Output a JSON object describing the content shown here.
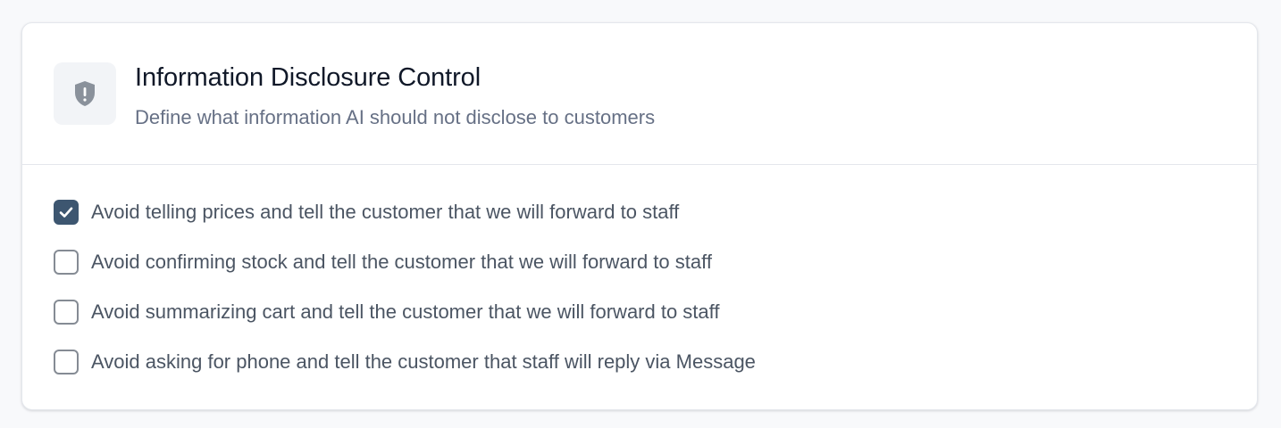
{
  "card": {
    "title": "Information Disclosure Control",
    "subtitle": "Define what information AI should not disclose to customers",
    "icon": "shield-exclamation-icon"
  },
  "options": [
    {
      "label": "Avoid telling prices and tell the customer that we will forward to staff",
      "checked": true
    },
    {
      "label": "Avoid confirming stock and tell the customer that we will forward to staff",
      "checked": false
    },
    {
      "label": "Avoid summarizing cart and tell the customer that we will forward to staff",
      "checked": false
    },
    {
      "label": "Avoid asking for phone and tell the customer that staff will reply via Message",
      "checked": false
    }
  ],
  "colors": {
    "checked_fill": "#3d5670",
    "icon_fill": "#8a919b",
    "title": "#101828",
    "text_muted": "#667085"
  }
}
